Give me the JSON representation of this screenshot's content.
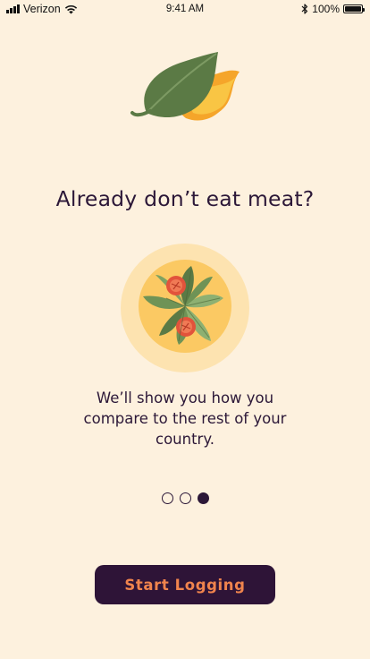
{
  "status_bar": {
    "carrier": "Verizon",
    "time": "9:41 AM",
    "battery_percent": "100%"
  },
  "onboarding": {
    "headline": "Already don’t eat meat?",
    "description": "We’ll show you how you compare to the rest of your country.",
    "pagination": {
      "total": 3,
      "active_index": 2
    },
    "cta_label": "Start Logging"
  },
  "colors": {
    "background": "#fdf1de",
    "text": "#2c1838",
    "button_bg": "#2e1437",
    "button_text": "#f0844d",
    "leaf_green": "#5b7a45",
    "flame_orange": "#f5a52a",
    "plate_outer": "#fde3b0",
    "plate_inner": "#fbc963",
    "tomato": "#e2533b"
  },
  "icons": {
    "logo": "leaf-flame-logo",
    "illustration": "salad-plate-illustration",
    "signal": "cellular-signal-icon",
    "wifi": "wifi-icon",
    "bluetooth": "bluetooth-icon",
    "battery": "battery-icon"
  }
}
